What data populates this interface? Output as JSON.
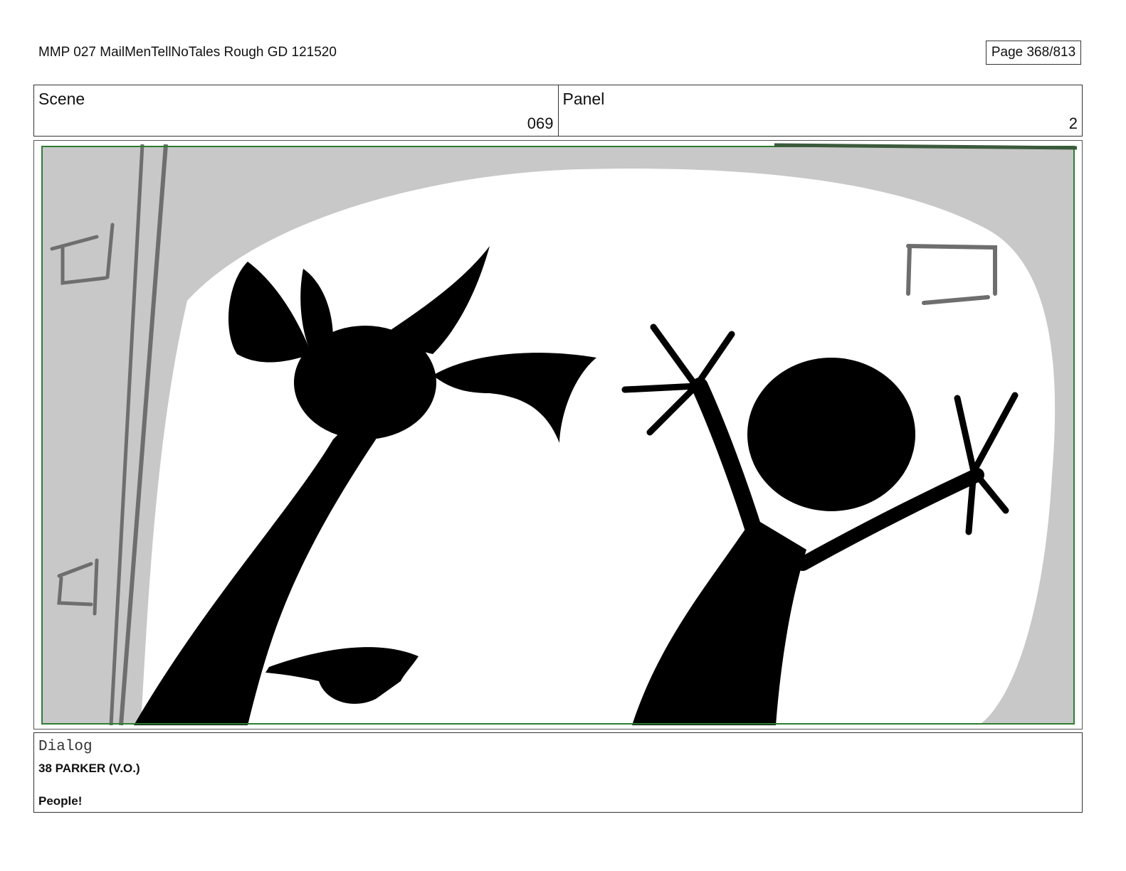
{
  "document": {
    "title": "MMP 027 MailMenTellNoTales Rough GD 121520",
    "page": "Page 368/813"
  },
  "scene": {
    "label": "Scene",
    "value": "069"
  },
  "panel": {
    "label": "Panel",
    "value": "2"
  },
  "dialog": {
    "label": "Dialog",
    "speaker": "38 PARKER (V.O.)",
    "line": "People!"
  },
  "colors": {
    "frame_border": "#2e7d32",
    "background_grey": "#c8c8c8",
    "silhouette": "#000000",
    "sketch_line": "#6e6e6e"
  }
}
